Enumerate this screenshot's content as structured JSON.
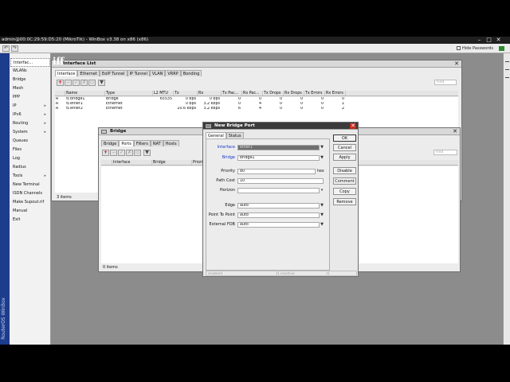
{
  "app": {
    "title": "admin@00:0C:29:59:D5:20 (MikroTik) - WinBox v3.38 on x86 (x86)",
    "hide_passwords": "Hide Passwords",
    "side_brand": "RouterOS WinBox"
  },
  "sidebar": {
    "items": [
      {
        "label": "Interfac…",
        "arrow": false,
        "active": true
      },
      {
        "label": "WLANs",
        "arrow": false,
        "active": false
      },
      {
        "label": "Bridge",
        "arrow": false,
        "active": false
      },
      {
        "label": "Mesh",
        "arrow": false,
        "active": false
      },
      {
        "label": "PPP",
        "arrow": false,
        "active": false
      },
      {
        "label": "IP",
        "arrow": true,
        "active": false
      },
      {
        "label": "IPv6",
        "arrow": true,
        "active": false
      },
      {
        "label": "Routing",
        "arrow": true,
        "active": false
      },
      {
        "label": "System",
        "arrow": true,
        "active": false
      },
      {
        "label": "Queues",
        "arrow": false,
        "active": false
      },
      {
        "label": "Files",
        "arrow": false,
        "active": false
      },
      {
        "label": "Log",
        "arrow": false,
        "active": false
      },
      {
        "label": "Radius",
        "arrow": false,
        "active": false
      },
      {
        "label": "Tools",
        "arrow": true,
        "active": false
      },
      {
        "label": "New Terminal",
        "arrow": false,
        "active": false
      },
      {
        "label": "ISDN Channels",
        "arrow": false,
        "active": false
      },
      {
        "label": "Make Supout.rif",
        "arrow": false,
        "active": false
      },
      {
        "label": "Manual",
        "arrow": false,
        "active": false
      },
      {
        "label": "Exit",
        "arrow": false,
        "active": false
      }
    ]
  },
  "interface_list": {
    "title": "Interface List",
    "tabs": [
      "Interface",
      "Ethernet",
      "EoIP Tunnel",
      "IP Tunnel",
      "VLAN",
      "VRRP",
      "Bonding"
    ],
    "find": "Find",
    "columns": [
      "",
      "Name",
      "Type",
      "L2 MTU",
      "Tx",
      "Rx",
      "Tx Pac...",
      "Rx Pac...",
      "Tx Drops",
      "Rx Drops",
      "Tx Errors",
      "Rx Errors"
    ],
    "rows": [
      [
        "R",
        "bridge1",
        "Bridge",
        "65535",
        "0 bps",
        "0 bps",
        "0",
        "0",
        "0",
        "0",
        "0",
        "0"
      ],
      [
        "R",
        "ether1",
        "Ethernet",
        "",
        "0 bps",
        "3.2 kbps",
        "0",
        "4",
        "0",
        "0",
        "0",
        "1"
      ],
      [
        "R",
        "ether2",
        "Ethernet",
        "",
        "20.6 kbps",
        "3.2 kbps",
        "6",
        "4",
        "0",
        "0",
        "0",
        "2"
      ]
    ],
    "status": "3 items"
  },
  "bridge": {
    "title": "Bridge",
    "tabs": [
      "Bridge",
      "Ports",
      "Filters",
      "NAT",
      "Hosts"
    ],
    "find": "Find",
    "columns": [
      "",
      "Interface",
      "Bridge",
      "Priority"
    ],
    "status": "0 items"
  },
  "dialog": {
    "title": "New Bridge Port",
    "tabs": [
      "General",
      "Status"
    ],
    "fields": {
      "interface": {
        "label": "Interface",
        "value": "ether1"
      },
      "bridge": {
        "label": "Bridge",
        "value": "bridge1"
      },
      "priority": {
        "label": "Priority",
        "value": "80",
        "unit": "hex"
      },
      "path_cost": {
        "label": "Path Cost",
        "value": "10"
      },
      "horizon": {
        "label": "Horizon",
        "value": ""
      },
      "edge": {
        "label": "Edge",
        "value": "auto"
      },
      "point_to_point": {
        "label": "Point To Point",
        "value": "auto"
      },
      "external_fdb": {
        "label": "External FDB",
        "value": "auto"
      }
    },
    "buttons": [
      "OK",
      "Cancel",
      "Apply",
      "Disable",
      "Comment",
      "Copy",
      "Remove"
    ],
    "status_left": "enabled",
    "status_mid": "inactive"
  }
}
